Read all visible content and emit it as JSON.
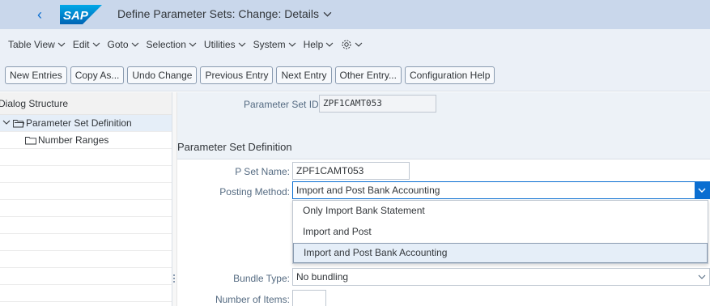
{
  "window": {
    "title": "Define Parameter Sets: Change: Details",
    "logo_text": "SAP",
    "brand_color": "#0070c0"
  },
  "menu": {
    "items": [
      "Table View",
      "Edit",
      "Goto",
      "Selection",
      "Utilities",
      "System",
      "Help"
    ],
    "settings_icon": "gear-icon"
  },
  "toolbar": {
    "buttons": [
      "New Entries",
      "Copy As...",
      "Undo Change",
      "Previous Entry",
      "Next Entry",
      "Other Entry...",
      "Configuration Help"
    ]
  },
  "dialog_structure": {
    "header": "Dialog Structure",
    "nodes": [
      {
        "label": "Parameter Set Definition",
        "expanded": true,
        "selected": true
      },
      {
        "label": "Number Ranges",
        "expanded": false,
        "selected": false
      }
    ]
  },
  "parameter_set": {
    "id_label": "Parameter Set ID:",
    "id_value": "ZPF1CAMT053"
  },
  "section": {
    "title": "Parameter Set Definition"
  },
  "form": {
    "pset_name_label": "P Set Name:",
    "pset_name_value": "ZPF1CAMT053",
    "posting_method_label": "Posting Method:",
    "posting_method_value": "Import and Post Bank Accounting",
    "posting_method_options": [
      "Only Import Bank Statement",
      "Import and Post",
      "Import and Post Bank Accounting"
    ],
    "bundle_type_label": "Bundle Type:",
    "bundle_type_value": "No bundling",
    "number_of_items_label": "Number of Items:",
    "number_of_items_value": ""
  }
}
